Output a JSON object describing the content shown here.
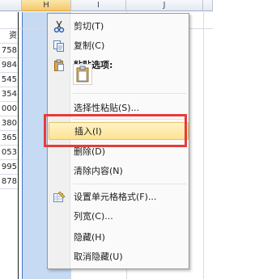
{
  "sheet": {
    "columns": [
      "H",
      "I",
      "J"
    ],
    "selected_column": "H",
    "visible_values": [
      "资",
      "758",
      "984",
      "545",
      "354",
      "000",
      "380",
      "365",
      "053",
      "995",
      "878"
    ]
  },
  "context_menu": {
    "items": [
      {
        "label": "剪切(T)",
        "icon": "scissors-icon"
      },
      {
        "label": "复制(C)",
        "icon": "copy-icon"
      },
      {
        "label": "粘贴选项:",
        "icon": "clipboard-icon",
        "bold": true
      },
      {
        "label": "选择性粘贴(S)..."
      },
      {
        "label": "插入(I)",
        "highlighted": true
      },
      {
        "label": "删除(D)"
      },
      {
        "label": "清除内容(N)"
      },
      {
        "label": "设置单元格格式(F)...",
        "icon": "format-cells-icon"
      },
      {
        "label": "列宽(C)..."
      },
      {
        "label": "隐藏(H)"
      },
      {
        "label": "取消隐藏(U)"
      }
    ]
  },
  "colors": {
    "selection": "#c7daf4",
    "highlight_border": "#e83a3a",
    "menu_hover": "#fde391"
  }
}
